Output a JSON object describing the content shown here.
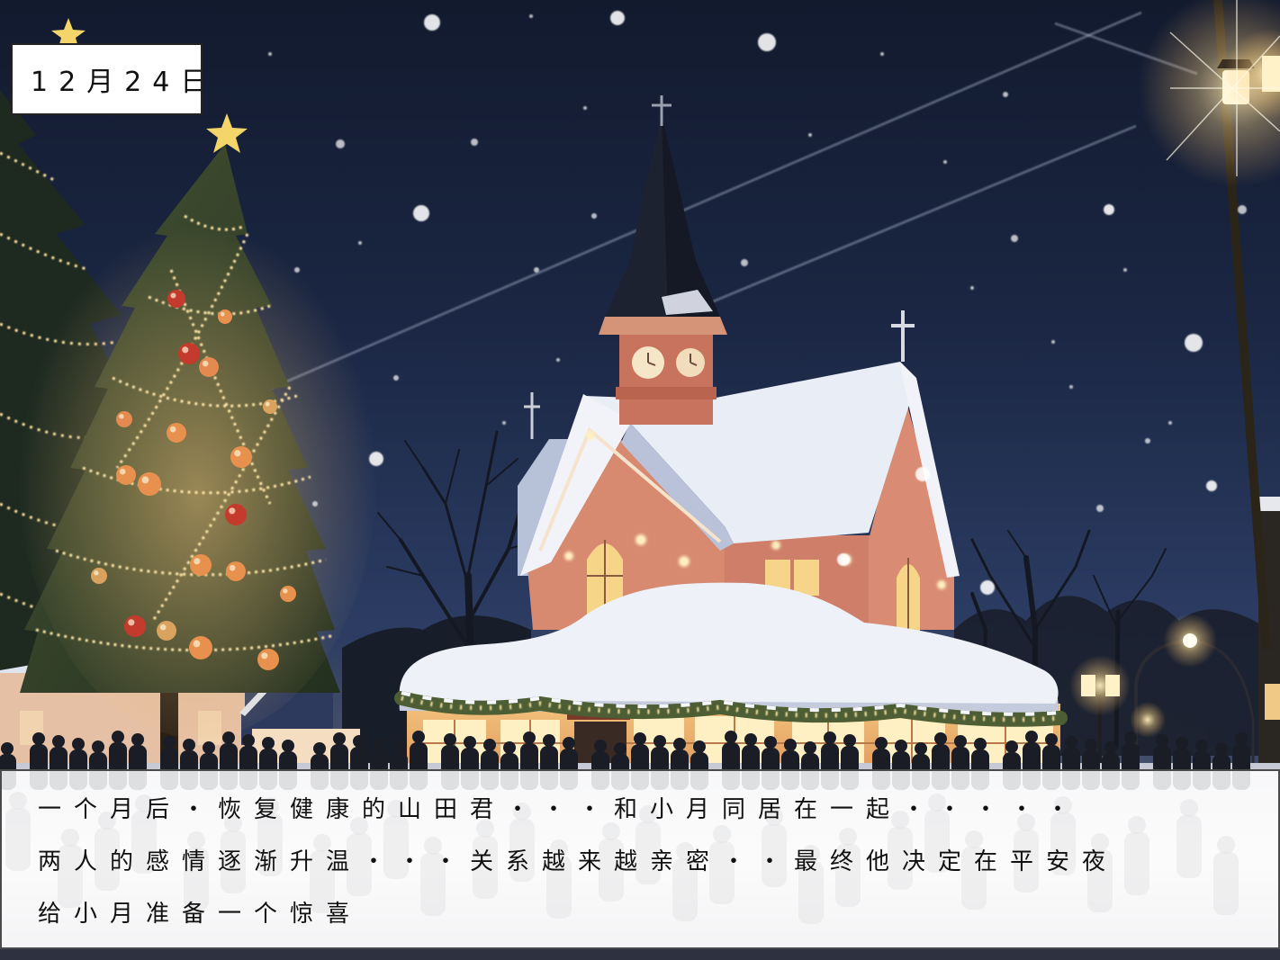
{
  "scene": {
    "date": "12月24日"
  },
  "dialogue": {
    "lines": [
      "一个月后・恢复健康的山田君・・・和小月同居在一起・・・・・",
      "两人的感情逐渐升温・・・关系越来越亲密・・最终他决定在平安夜",
      "给小月准备一个惊喜"
    ]
  },
  "colors": {
    "sky_top": "#121a2e",
    "sky_horizon": "#34446a",
    "snow": "#eef1f8",
    "church_wall": "#d5856e",
    "tree_lights": "#ffe3a0",
    "lamp_glow": "#fff1c2",
    "text": "#111111",
    "box_border": "#4a4a4a"
  }
}
